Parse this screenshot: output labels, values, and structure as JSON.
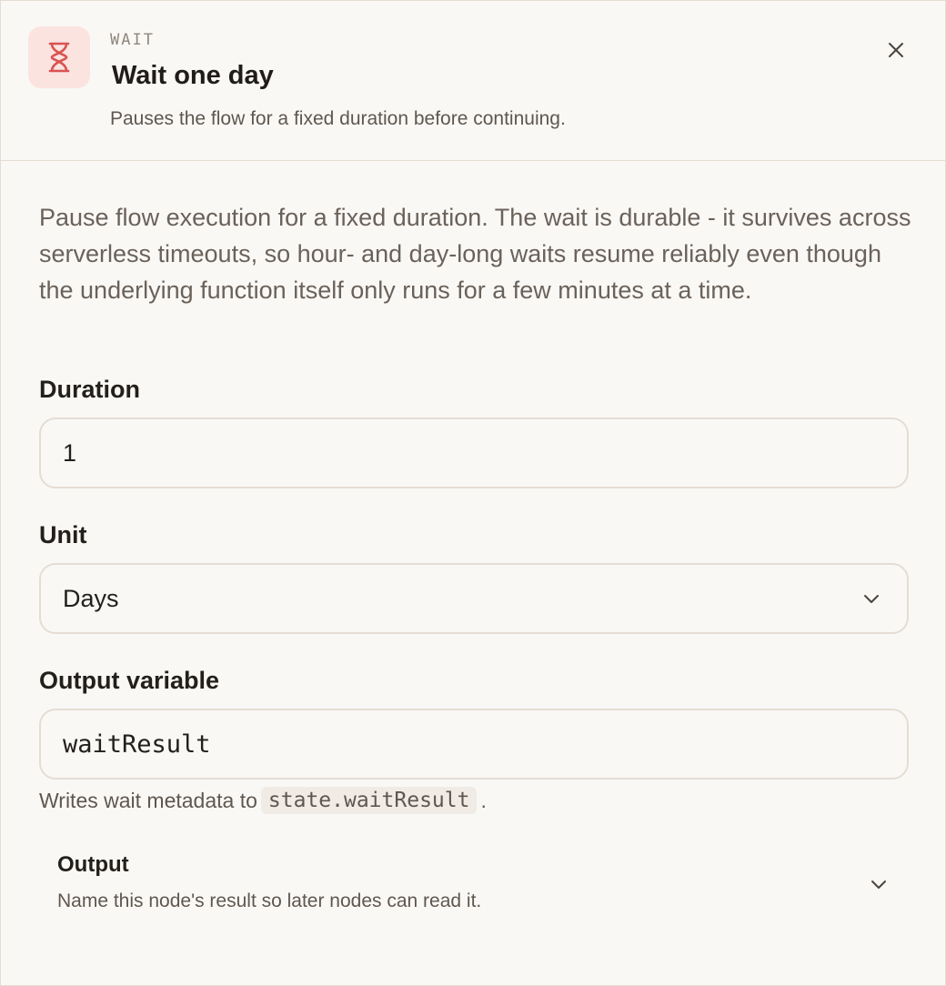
{
  "header": {
    "kind": "WAIT",
    "title": "Wait one day",
    "subtitle": "Pauses the flow for a fixed duration before continuing.",
    "icon": "hourglass-icon",
    "accent_color": "#d9534f"
  },
  "description": "Pause flow execution for a fixed duration. The wait is durable - it survives across serverless timeouts, so hour- and day-long waits resume reliably even though the underlying function itself only runs for a few minutes at a time.",
  "fields": {
    "duration": {
      "label": "Duration",
      "value": "1"
    },
    "unit": {
      "label": "Unit",
      "value": "Days"
    },
    "output_variable": {
      "label": "Output variable",
      "value": "waitResult",
      "hint_prefix": "Writes wait metadata to",
      "hint_code": "state.waitResult",
      "hint_suffix": "."
    }
  },
  "output_section": {
    "title": "Output",
    "subtitle": "Name this node's result so later nodes can read it."
  }
}
